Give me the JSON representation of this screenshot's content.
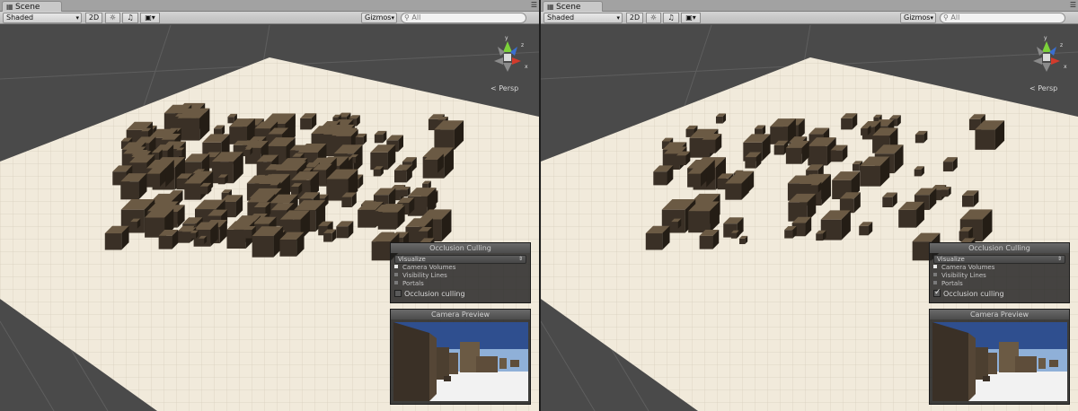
{
  "panes": [
    {
      "tab_label": "Scene",
      "shading_mode": "Shaded",
      "mode_2d_label": "2D",
      "gizmos_label": "Gizmos",
      "search_placeholder": "All",
      "persp_label": "Persp",
      "axis_labels": {
        "x": "x",
        "y": "y",
        "z": "z"
      },
      "occlusion": {
        "title": "Occlusion Culling",
        "mode": "Visualize",
        "options": [
          "Camera Volumes",
          "Visibility Lines",
          "Portals"
        ],
        "selected_option": "Camera Volumes",
        "checkbox_label": "Occlusion culling",
        "checked": false
      },
      "camera_preview_title": "Camera Preview"
    },
    {
      "tab_label": "Scene",
      "shading_mode": "Shaded",
      "mode_2d_label": "2D",
      "gizmos_label": "Gizmos",
      "search_placeholder": "All",
      "persp_label": "Persp",
      "axis_labels": {
        "x": "x",
        "y": "y",
        "z": "z"
      },
      "occlusion": {
        "title": "Occlusion Culling",
        "mode": "Visualize",
        "options": [
          "Camera Volumes",
          "Visibility Lines",
          "Portals"
        ],
        "selected_option": "Camera Volumes",
        "checkbox_label": "Occlusion culling",
        "checked": true
      },
      "camera_preview_title": "Camera Preview"
    }
  ],
  "icons": {
    "tab": "grid-icon",
    "menu": "pane-menu-icon",
    "lighting": "sun-icon",
    "audio": "speaker-icon",
    "effects": "image-icon",
    "search": "search-icon"
  },
  "colors": {
    "ground": "#f1eadb",
    "background": "#4a4a4a",
    "cube_dark": "#2e261c",
    "cube_light": "#6b5a44"
  }
}
